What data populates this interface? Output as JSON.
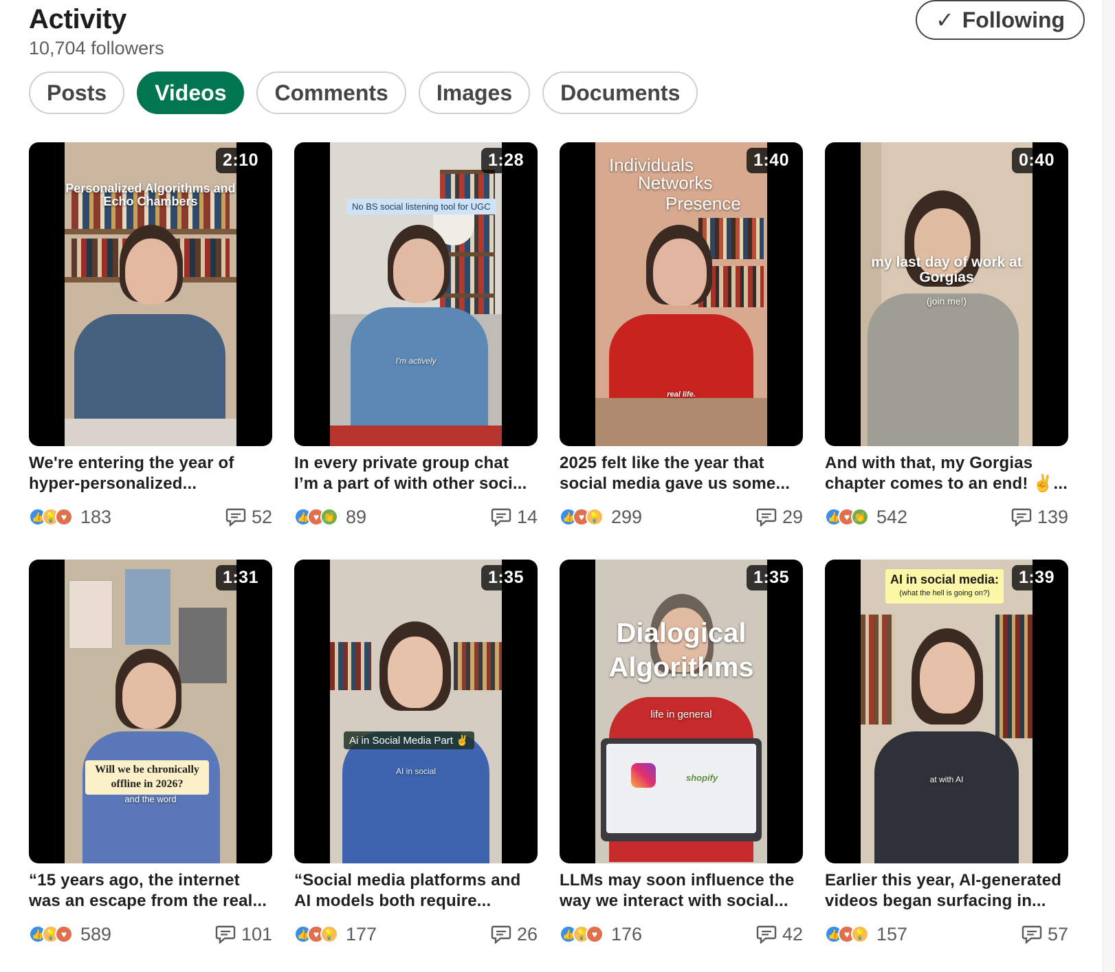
{
  "header": {
    "title": "Activity",
    "followers": "10,704 followers",
    "follow_button": "Following",
    "follow_check": "✓"
  },
  "tabs": [
    {
      "label": "Posts",
      "active": false
    },
    {
      "label": "Videos",
      "active": true
    },
    {
      "label": "Comments",
      "active": false
    },
    {
      "label": "Images",
      "active": false
    },
    {
      "label": "Documents",
      "active": false
    }
  ],
  "videos": [
    {
      "duration": "2:10",
      "overlay": "Personalized Algorithms and Echo Chambers",
      "caption_line1": "We're entering the year of",
      "caption_line2": "hyper-personalized...",
      "reactions": [
        "like",
        "insight",
        "love"
      ],
      "reaction_count": "183",
      "comment_count": "52"
    },
    {
      "duration": "1:28",
      "overlay": "No BS social listening tool for UGC",
      "overlay_small": "I'm actively",
      "caption_line1": "In every private group chat",
      "caption_line2": "I’m a part of with other soci...",
      "reactions": [
        "like",
        "love",
        "support"
      ],
      "reaction_count": "89",
      "comment_count": "14"
    },
    {
      "duration": "1:40",
      "overlay_lines": [
        "Individuals",
        "Networks",
        "Presence"
      ],
      "overlay_small": "real life.",
      "caption_line1": "2025 felt like the year that",
      "caption_line2": "social media gave us some...",
      "reactions": [
        "like",
        "love",
        "insight"
      ],
      "reaction_count": "299",
      "comment_count": "29"
    },
    {
      "duration": "0:40",
      "overlay": "my last day of work at Gorgias",
      "overlay_small": "(join me!)",
      "caption_line1": "And with that, my Gorgias",
      "caption_line2": "chapter comes to an end! ✌️...",
      "reactions": [
        "like",
        "love",
        "support"
      ],
      "reaction_count": "542",
      "comment_count": "139"
    },
    {
      "duration": "1:31",
      "overlay": "Will we be chronically offline in 2026?",
      "overlay_small": "and the word",
      "caption_line1": "“15 years ago, the internet",
      "caption_line2": "was an escape from the real...",
      "reactions": [
        "like",
        "insight",
        "love"
      ],
      "reaction_count": "589",
      "comment_count": "101"
    },
    {
      "duration": "1:35",
      "overlay": "Ai in Social Media Part ✌️",
      "overlay_small": "AI in social",
      "caption_line1": "“Social media platforms and",
      "caption_line2": "AI models both require...",
      "reactions": [
        "like",
        "love",
        "insight"
      ],
      "reaction_count": "177",
      "comment_count": "26"
    },
    {
      "duration": "1:35",
      "overlay": "Dialogical Algorithms",
      "overlay_small": "life in general",
      "laptop_brand": "shopify",
      "caption_line1": "LLMs may soon influence the",
      "caption_line2": "way we interact with social...",
      "reactions": [
        "like",
        "insight",
        "love"
      ],
      "reaction_count": "176",
      "comment_count": "42"
    },
    {
      "duration": "1:39",
      "overlay": "AI in social media:",
      "overlay_sub": "(what the hell is going on?)",
      "overlay_small": "at with AI",
      "caption_line1": "Earlier this year, AI-generated",
      "caption_line2": "videos began surfacing in...",
      "reactions": [
        "like",
        "love",
        "insight"
      ],
      "reaction_count": "157",
      "comment_count": "57"
    }
  ],
  "colors": {
    "accent_green": "#01754f",
    "like": "#378fe9",
    "love": "#df704d",
    "insight": "#f5bb5c",
    "support": "#6dae4f"
  },
  "icons": {
    "like": "thumbs-up-icon",
    "love": "heart-icon",
    "insight": "lightbulb-icon",
    "support": "clapping-hands-icon",
    "comments": "comment-bubble-icon"
  }
}
